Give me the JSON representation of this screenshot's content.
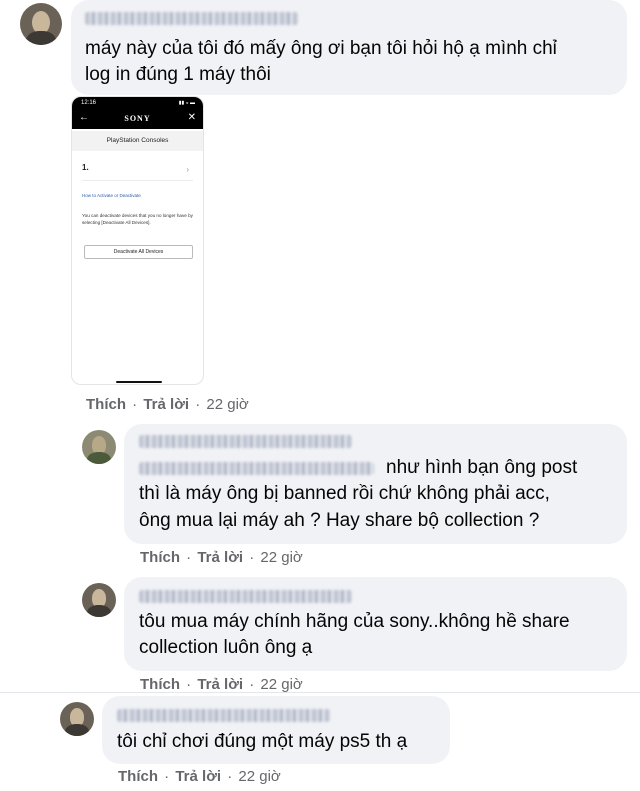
{
  "comments": [
    {
      "author": "Nguyễn Minh Đăng Khoa",
      "text_lines": [
        "máy này của tôi đó mấy ông ơi bạn tôi hỏi hộ ạ mình chỉ",
        "log in đúng 1 máy thôi"
      ],
      "actions": {
        "like": "Thích",
        "reply": "Trả lời",
        "time": "22 giờ"
      },
      "attachment": {
        "status_time": "12:16",
        "status_icons": "▮▮ ◒ ▬",
        "brand": "SONY",
        "back_icon": "←",
        "close_icon": "✕",
        "screen_title": "PlayStation Consoles",
        "device_label": "1.",
        "chevron": "›",
        "link_text": "How to Activate or Deactivate",
        "description": "You can deactivate devices that you no longer have by selecting [Deactivate All Devices].",
        "button_label": "Deactivate All Devices"
      }
    },
    {
      "author": "Nguyễn Minh Đăng Khoa",
      "mention": "Nguyễn Minh Đăng Khoa",
      "text_lines": [
        "như hình bạn ông post",
        "thì là máy ông bị banned rồi chứ không phải acc,",
        "ông mua lại máy ah ? Hay share bộ collection ?"
      ],
      "actions": {
        "like": "Thích",
        "reply": "Trả lời",
        "time": "22 giờ"
      }
    },
    {
      "author": "Nguyễn Minh Đăng Khoa",
      "text_lines": [
        "tôu mua máy chính hãng của sony..không hề share",
        "collection luôn ông ạ"
      ],
      "actions": {
        "like": "Thích",
        "reply": "Trả lời",
        "time": "22 giờ"
      }
    },
    {
      "author": "Nguyễn Minh Đăng Khoa",
      "text_lines": [
        "tôi chỉ chơi đúng một máy ps5 th ạ"
      ],
      "actions": {
        "like": "Thích",
        "reply": "Trả lời",
        "time": "22 giờ"
      }
    }
  ],
  "separator": "·",
  "colors": {
    "bubble": "#f0f2f5",
    "text": "#050505",
    "meta": "#65676b",
    "link": "#2a5aa8"
  }
}
